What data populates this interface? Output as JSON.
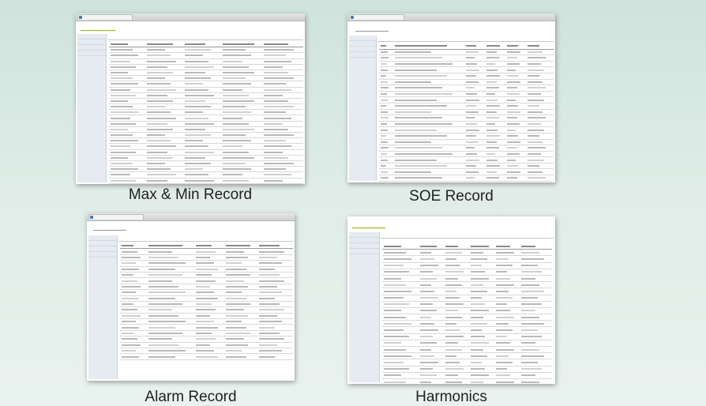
{
  "captions": {
    "maxmin": "Max & Min Record",
    "soe": "SOE Record",
    "alarm": "Alarm Record",
    "harmonics": "Harmonics"
  },
  "colors": {
    "background_top": "#cfe3dc",
    "background_bottom": "#e9f2ee",
    "logo": "#6a8a1e",
    "sidebar": "#e6ebf2"
  },
  "icons": [
    "browser-tab-icon"
  ]
}
